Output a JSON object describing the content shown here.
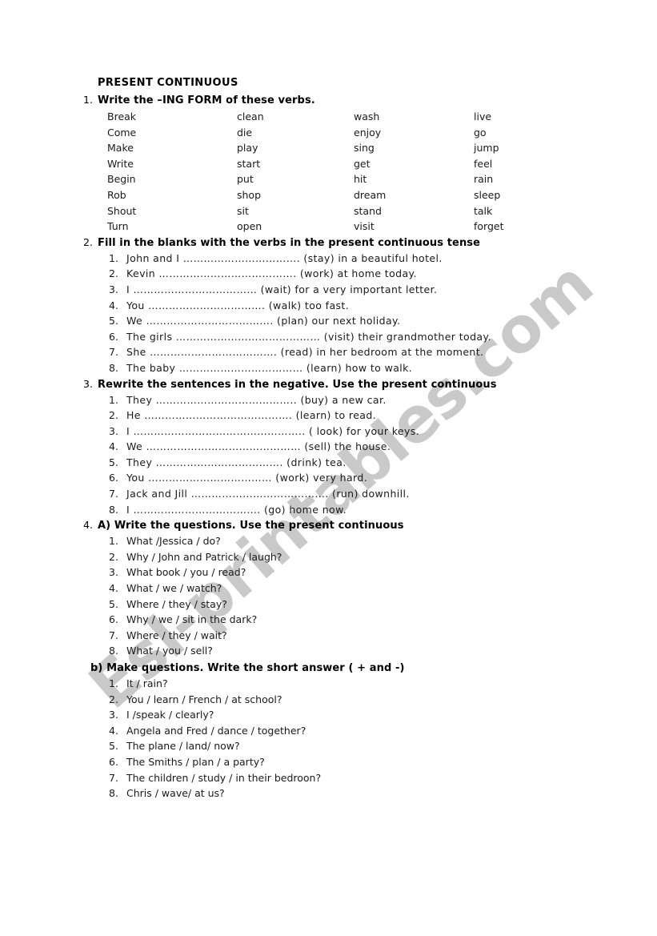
{
  "document": {
    "title": "PRESENT CONTINUOUS",
    "watermark": "Esl-printables.com",
    "watermark_color": "#c9c9c9",
    "text_color": "#000000",
    "background_color": "#ffffff"
  },
  "sections": [
    {
      "number": "1.",
      "title": "Write the –ING FORM of these verbs.",
      "type": "verb-grid",
      "columns": 4,
      "rows": [
        [
          "Break",
          "clean",
          "wash",
          "live"
        ],
        [
          "Come",
          "die",
          "enjoy",
          "go"
        ],
        [
          "Make",
          "play",
          "sing",
          "jump"
        ],
        [
          "Write",
          "start",
          "get",
          "feel"
        ],
        [
          "Begin",
          "put",
          "hit",
          "rain"
        ],
        [
          "Rob",
          "shop",
          "dream",
          "sleep"
        ],
        [
          "Shout",
          "sit",
          "stand",
          "talk"
        ],
        [
          "Turn",
          "open",
          "visit",
          "forget"
        ]
      ]
    },
    {
      "number": "2.",
      "title": "Fill in the blanks with the verbs in the present continuous tense",
      "type": "numbered-list",
      "items": [
        {
          "num": "1.",
          "text": "John and I ……………………………. (stay) in a beautiful hotel."
        },
        {
          "num": "2.",
          "text": "Kevin …………………………………. (work) at home today."
        },
        {
          "num": "3.",
          "text": "I ……………………………… (wait) for a very important letter."
        },
        {
          "num": "4.",
          "text": "You ……………………………. (walk) too fast."
        },
        {
          "num": "5.",
          "text": "We ………………………………. (plan) our next holiday."
        },
        {
          "num": "6.",
          "text": "The girls …………………………………… (visit) their grandmother today."
        },
        {
          "num": "7.",
          "text": "She ………………………………. (read) in her bedroom at the moment."
        },
        {
          "num": "8.",
          "text": "The baby ……………………………… (learn) how to walk."
        }
      ]
    },
    {
      "number": "3.",
      "title": "Rewrite the sentences in the negative. Use the present continuous",
      "type": "numbered-list",
      "items": [
        {
          "num": "1.",
          "text": "They ………………………………….. (buy) a new car."
        },
        {
          "num": "2.",
          "text": "He ……………………………………. (learn) to read."
        },
        {
          "num": "3.",
          "text": "I ………………………………………….. ( look) for your keys."
        },
        {
          "num": "4.",
          "text": "We ……………………………………… (sell) the house."
        },
        {
          "num": "5.",
          "text": "They ………………………………. (drink) tea."
        },
        {
          "num": "6.",
          "text": "You ……………………………… (work) very hard."
        },
        {
          "num": "7.",
          "text": "Jack and Jill …………………………………. (run) downhill."
        },
        {
          "num": "8.",
          "text": "I ………………………………. (go) home now."
        }
      ]
    },
    {
      "number": "4.",
      "title": "A) Write the questions. Use the present continuous",
      "type": "numbered-list",
      "items": [
        {
          "num": "1.",
          "text": "What /Jessica / do?"
        },
        {
          "num": "2.",
          "text": "Why / John and Patrick / laugh?"
        },
        {
          "num": "3.",
          "text": "What book / you / read?"
        },
        {
          "num": "4.",
          "text": "What / we / watch?"
        },
        {
          "num": "5.",
          "text": "Where / they / stay?"
        },
        {
          "num": "6.",
          "text": "Why / we / sit in the dark?"
        },
        {
          "num": "7.",
          "text": "Where / they  / wait?"
        },
        {
          "num": "8.",
          "text": "What / you / sell?"
        }
      ]
    }
  ],
  "subsection_b": {
    "title": "b) Make questions. Write the short answer ( + and -)",
    "items": [
      {
        "num": "1.",
        "text": "It / rain?"
      },
      {
        "num": "2.",
        "text": "You / learn / French / at school?"
      },
      {
        "num": "3.",
        "text": "I /speak / clearly?"
      },
      {
        "num": "4.",
        "text": "Angela and Fred / dance / together?"
      },
      {
        "num": "5.",
        "text": "The plane / land/ now?"
      },
      {
        "num": "6.",
        "text": "The Smiths / plan / a party?"
      },
      {
        "num": "7.",
        "text": "The children / study / in their bedroon?"
      },
      {
        "num": "8.",
        "text": "Chris / wave/ at us?"
      }
    ]
  }
}
